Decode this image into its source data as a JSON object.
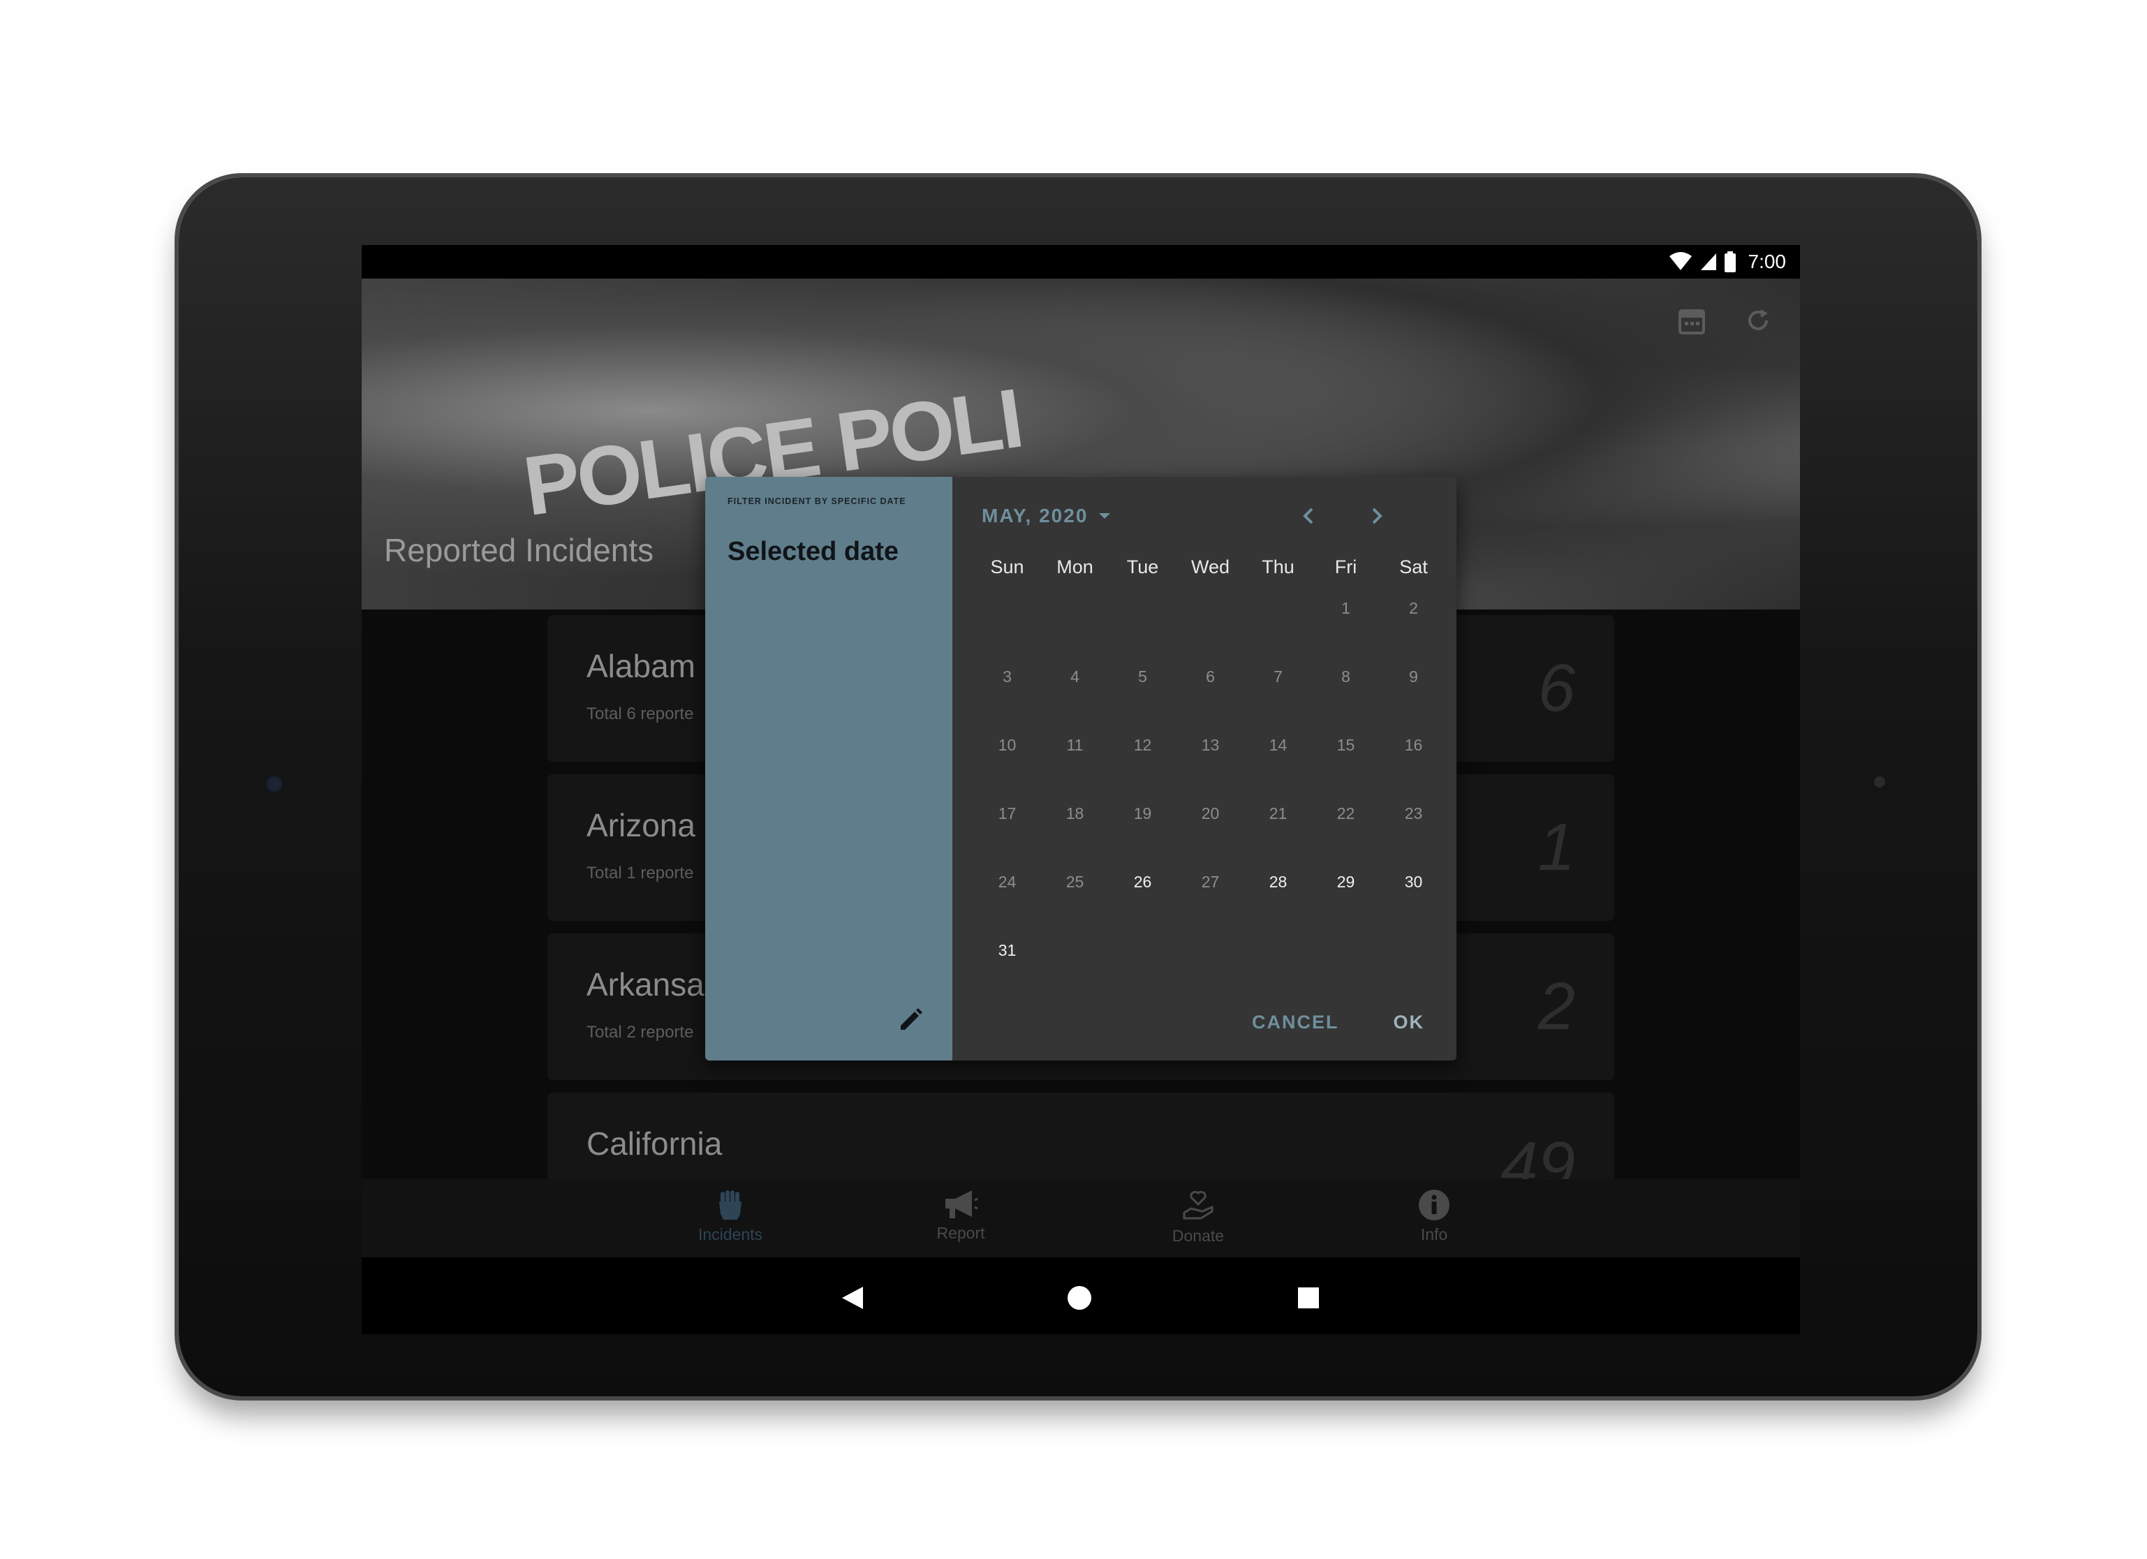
{
  "status_bar": {
    "time": "7:00",
    "icons": [
      "wifi-icon",
      "signal-icon",
      "battery-icon"
    ]
  },
  "header": {
    "title": "Reported Incidents",
    "image_text": "POLICE POLI",
    "actions": [
      "calendar-icon",
      "refresh-icon"
    ]
  },
  "incidents": [
    {
      "state": "Alabam",
      "subtitle": "Total 6 reporte",
      "count": "6"
    },
    {
      "state": "Arizona",
      "subtitle": "Total 1 reporte",
      "count": "1"
    },
    {
      "state": "Arkansa",
      "subtitle": "Total 2 reporte",
      "count": "2"
    },
    {
      "state": "California",
      "subtitle": "",
      "count": "49"
    }
  ],
  "bottom_nav": [
    {
      "label": "Incidents",
      "icon": "raised-fist-icon",
      "active": true
    },
    {
      "label": "Report",
      "icon": "megaphone-icon",
      "active": false
    },
    {
      "label": "Donate",
      "icon": "donate-heart-hand-icon",
      "active": false
    },
    {
      "label": "Info",
      "icon": "info-icon",
      "active": false
    }
  ],
  "dialog": {
    "overline": "FILTER INCIDENT BY SPECIFIC DATE",
    "selected_label": "Selected date",
    "month_label": "MAY, 2020",
    "weekdays": [
      "Sun",
      "Mon",
      "Tue",
      "Wed",
      "Thu",
      "Fri",
      "Sat"
    ],
    "days": [
      "1",
      "2",
      "3",
      "4",
      "5",
      "6",
      "7",
      "8",
      "9",
      "10",
      "11",
      "12",
      "13",
      "14",
      "15",
      "16",
      "17",
      "18",
      "19",
      "20",
      "21",
      "22",
      "23",
      "24",
      "25",
      "26",
      "27",
      "28",
      "29",
      "30",
      "31"
    ],
    "first_weekday_index": 5,
    "enabled_days": [
      "26",
      "28",
      "29",
      "30",
      "31"
    ],
    "cancel_label": "CANCEL",
    "ok_label": "OK",
    "accent_color": "#607d8b"
  }
}
